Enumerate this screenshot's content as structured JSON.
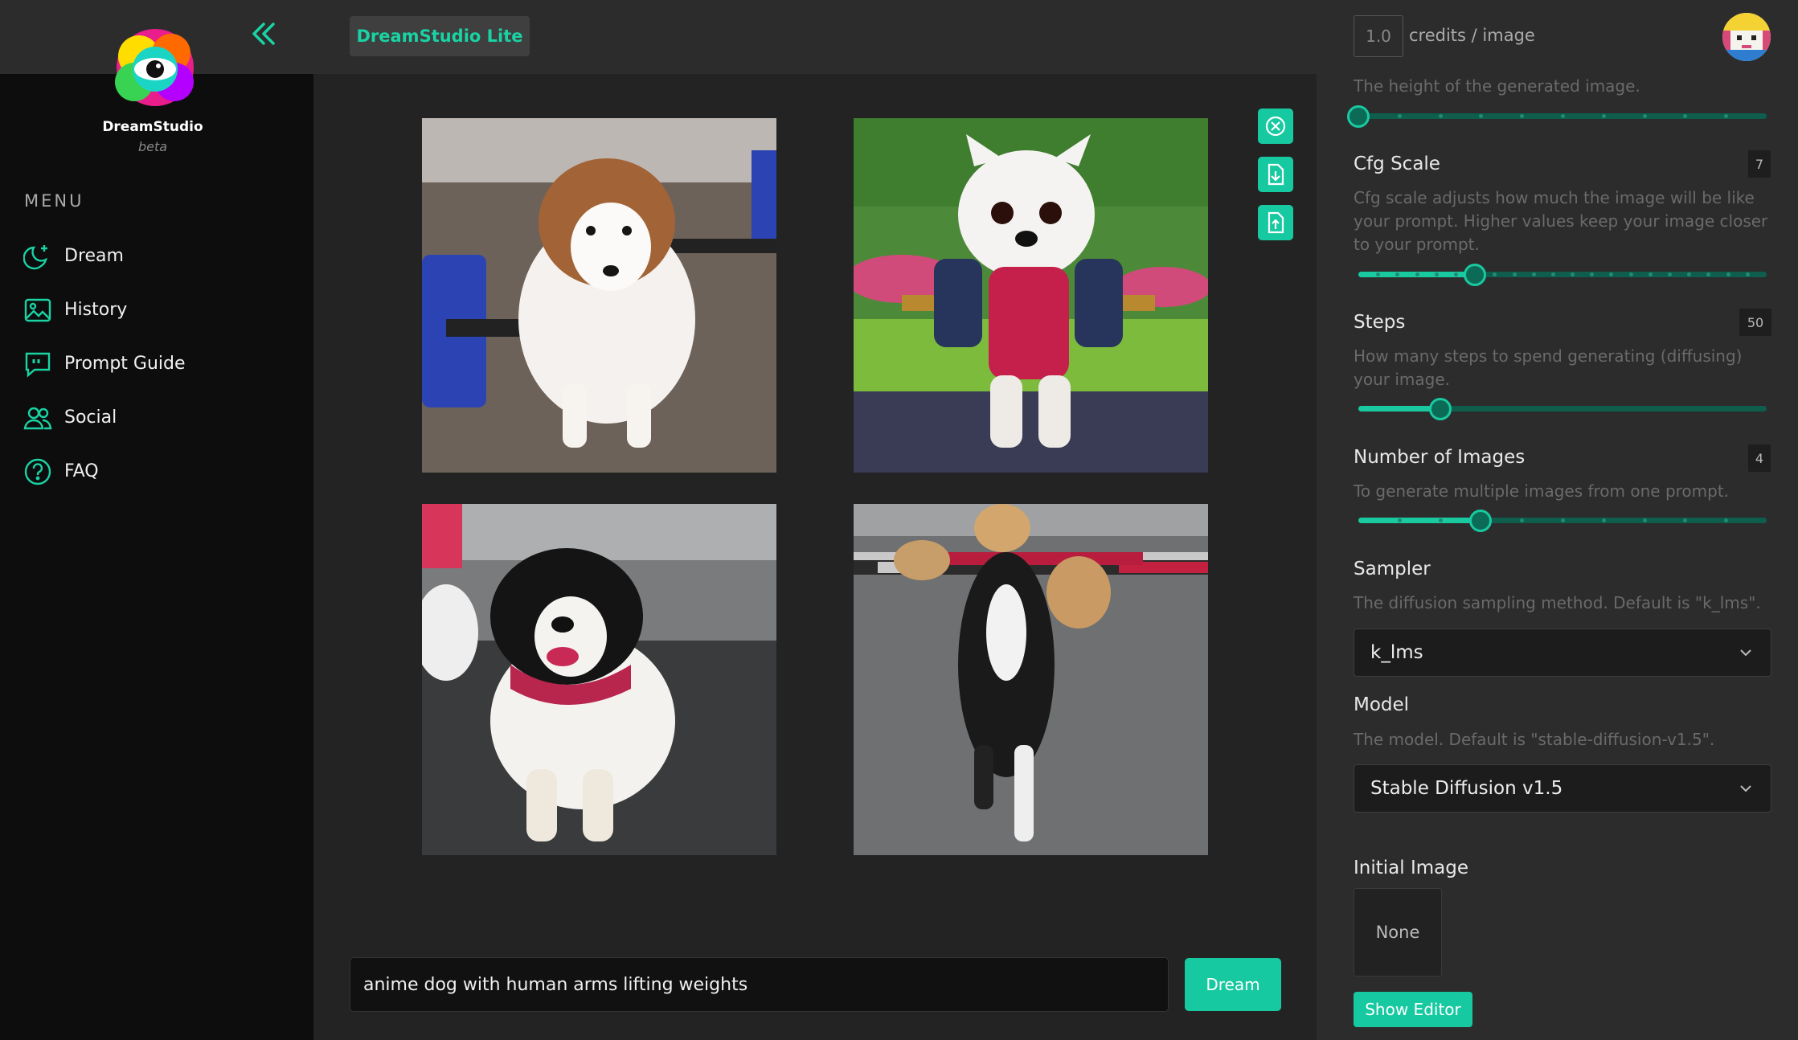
{
  "brand": {
    "name": "DreamStudio",
    "subtitle": "beta"
  },
  "app_title": "DreamStudio Lite",
  "menu": {
    "heading": "MENU",
    "items": [
      {
        "label": "Dream",
        "icon": "moon-sparkle-icon"
      },
      {
        "label": "History",
        "icon": "image-gallery-icon"
      },
      {
        "label": "Prompt Guide",
        "icon": "quote-bubble-icon"
      },
      {
        "label": "Social",
        "icon": "users-icon"
      },
      {
        "label": "FAQ",
        "icon": "question-circle-icon"
      }
    ]
  },
  "toolbar": {
    "icons": [
      "close-circle-icon",
      "download-file-icon",
      "upload-file-icon"
    ]
  },
  "prompt": {
    "value": "anime dog with human arms lifting weights",
    "button": "Dream"
  },
  "header": {
    "credits_value": "1.0",
    "credits_label": "credits / image"
  },
  "settings": {
    "height": {
      "description": "The height of the generated image.",
      "fraction": 0.0
    },
    "cfg": {
      "label": "Cfg Scale",
      "value": "7",
      "description": "Cfg scale adjusts how much the image will be like your prompt. Higher values keep your image closer to your prompt.",
      "fraction": 0.2857
    },
    "steps": {
      "label": "Steps",
      "value": "50",
      "description": "How many steps to spend generating (diffusing) your image.",
      "fraction": 0.2
    },
    "images": {
      "label": "Number of Images",
      "value": "4",
      "description": "To generate multiple images from one prompt.",
      "fraction": 0.3
    },
    "sampler": {
      "label": "Sampler",
      "description": "The diffusion sampling method. Default is \"k_lms\".",
      "value": "k_lms"
    },
    "model": {
      "label": "Model",
      "description": "The model. Default is \"stable-diffusion-v1.5\".",
      "value": "Stable Diffusion v1.5"
    },
    "initial_image": {
      "label": "Initial Image",
      "value": "None",
      "button": "Show Editor"
    }
  },
  "colors": {
    "accent": "#16c9a0",
    "sidebar": "#0d0d0d",
    "panel": "#2c2c2c"
  }
}
